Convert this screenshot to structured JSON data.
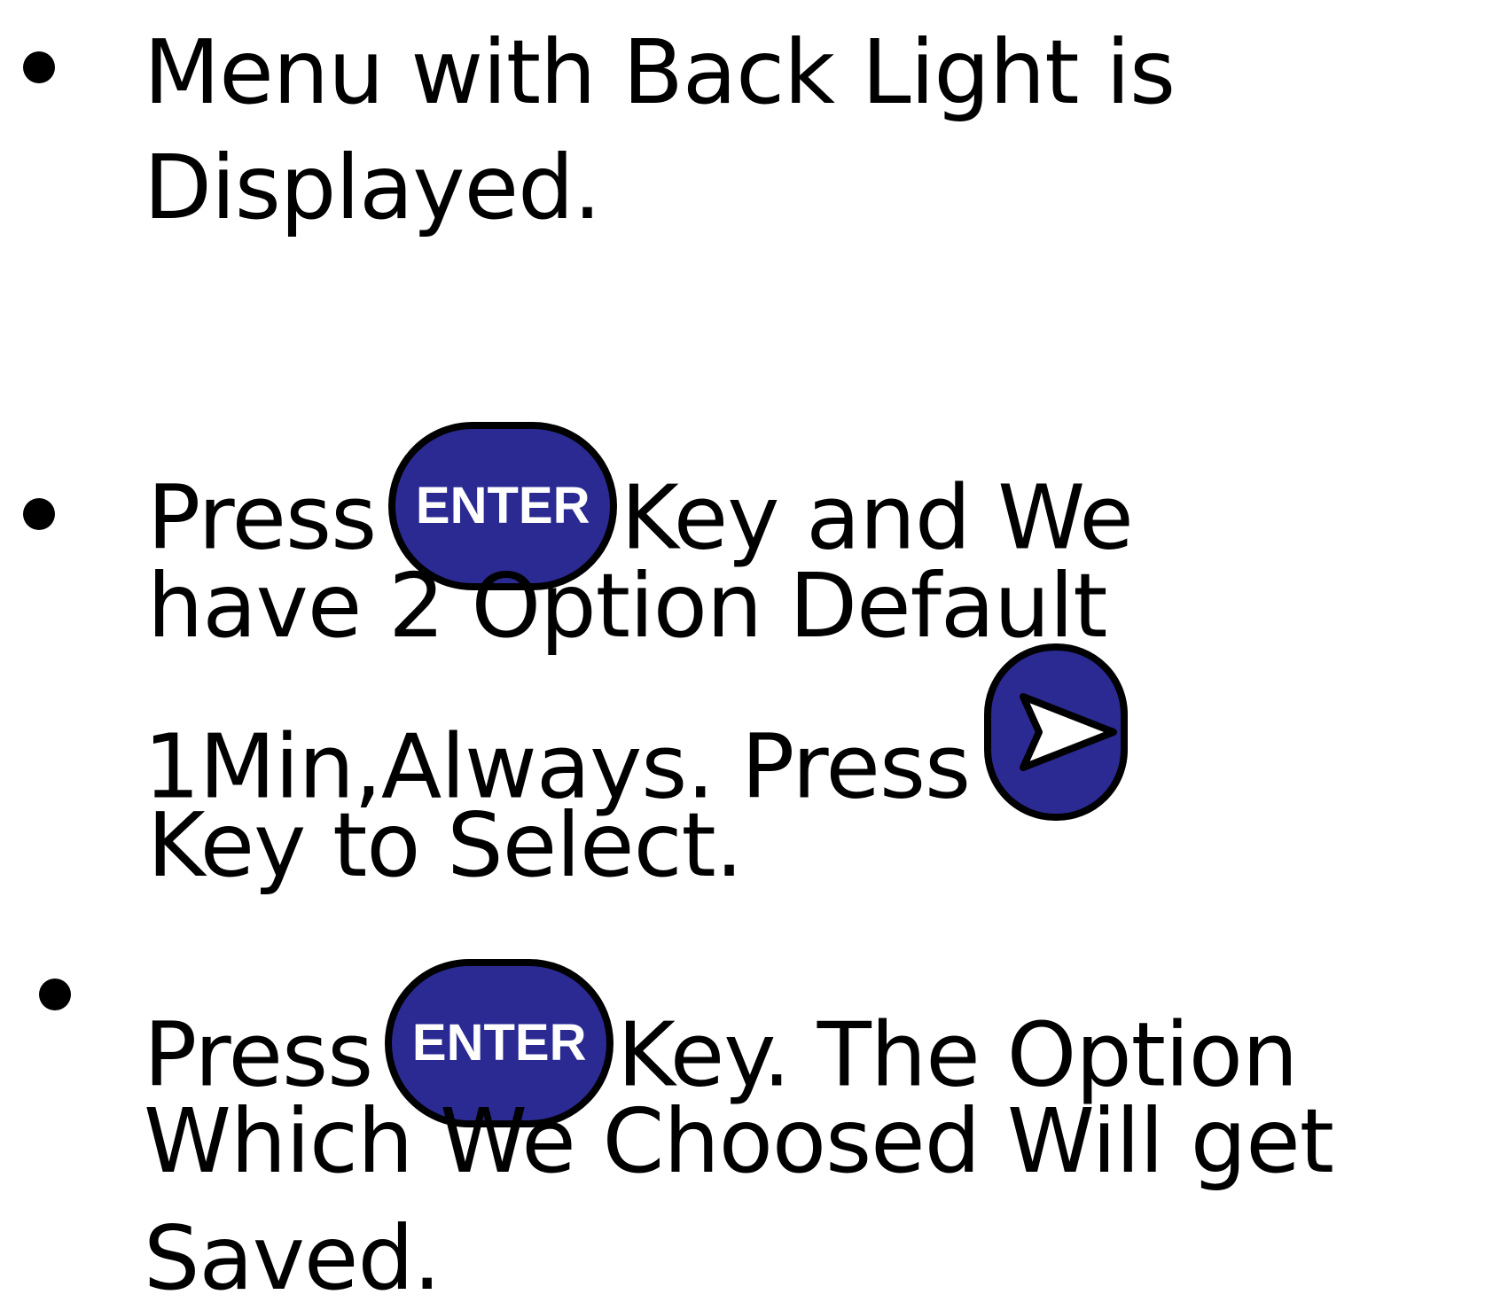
{
  "bullets": [
    {
      "lines": [
        "Menu with Back Light is",
        "Displayed."
      ]
    },
    {
      "line1_before": "Press",
      "line1_key": "ENTER",
      "line1_after": "Key and We",
      "line2": "have 2 Option Default",
      "line3_before": "1Min,Always. Press",
      "line3_key_icon": "right-arrow-key-icon",
      "line4": "Key to Select."
    },
    {
      "line1_before": "Press",
      "line1_key": "ENTER",
      "line1_after": "Key. The Option",
      "line2": "Which We Choosed Will get",
      "line3": "Saved."
    }
  ],
  "colors": {
    "key_fill": "#2a2a92",
    "key_border": "#000000",
    "key_text": "#ffffff",
    "body_text": "#000000"
  }
}
